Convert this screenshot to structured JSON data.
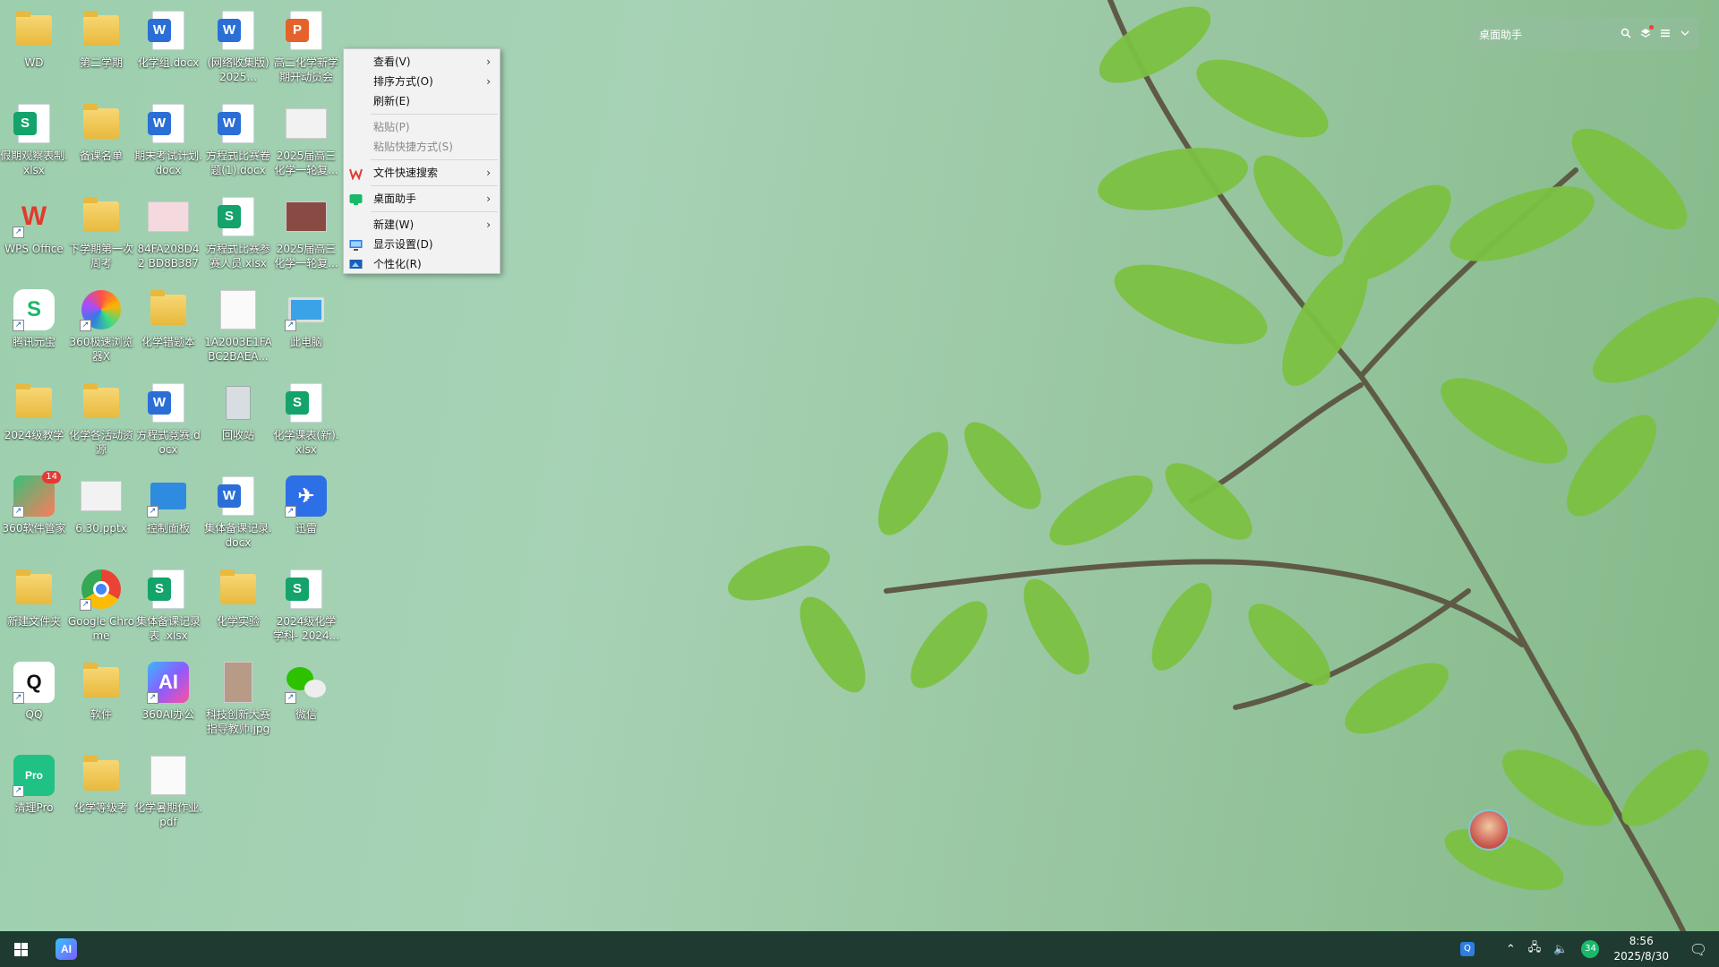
{
  "desktop_icons": [
    {
      "label": "WD",
      "kind": "folder-user"
    },
    {
      "label": "第二学期",
      "kind": "folder"
    },
    {
      "label": "化学组.docx",
      "kind": "word"
    },
    {
      "label": "(网络收集版) 2025...",
      "kind": "word"
    },
    {
      "label": "高二化学新学期开动员会(p...",
      "kind": "ppt"
    },
    {
      "label": "假期观察表制.xlsx",
      "kind": "excel"
    },
    {
      "label": "备课名单",
      "kind": "folder"
    },
    {
      "label": "期末考试计划.docx",
      "kind": "word"
    },
    {
      "label": "方程式比赛卷题(1).docx",
      "kind": "word"
    },
    {
      "label": "2025届高三化学一轮复...",
      "kind": "thumb"
    },
    {
      "label": "WPS Office",
      "kind": "wps"
    },
    {
      "label": "下学期第一次周考",
      "kind": "folder"
    },
    {
      "label": "84FA208D42 BD8B387F...",
      "kind": "thumb-pink"
    },
    {
      "label": "方程式比赛参赛人员.xlsx",
      "kind": "excel"
    },
    {
      "label": "2025届高三化学一轮复...",
      "kind": "thumb-photo"
    },
    {
      "label": "腾讯元宝",
      "kind": "yuanbao"
    },
    {
      "label": "360极速浏览器X",
      "kind": "browser360"
    },
    {
      "label": "化学错题本",
      "kind": "folder-doc"
    },
    {
      "label": "1A2003E1FA BC2BAEA...",
      "kind": "thumb-doc"
    },
    {
      "label": "此电脑",
      "kind": "pc"
    },
    {
      "label": "2024级教学",
      "kind": "folder"
    },
    {
      "label": "化学各活动资源",
      "kind": "folder-word"
    },
    {
      "label": "方程式竞赛.docx",
      "kind": "word"
    },
    {
      "label": "回收站",
      "kind": "recycle"
    },
    {
      "label": "化学课表(新).xlsx",
      "kind": "excel"
    },
    {
      "label": "360软件管家",
      "kind": "mgr360",
      "badge": "14"
    },
    {
      "label": "6.30.pptx",
      "kind": "thumb"
    },
    {
      "label": "控制面板",
      "kind": "control"
    },
    {
      "label": "集体备课记录.docx",
      "kind": "word"
    },
    {
      "label": "迅雷",
      "kind": "xunlei"
    },
    {
      "label": "新建文件夹",
      "kind": "folder"
    },
    {
      "label": "Google Chrome",
      "kind": "chrome"
    },
    {
      "label": "集体备课记录表 .xlsx",
      "kind": "excel"
    },
    {
      "label": "化学实验",
      "kind": "folder-doc"
    },
    {
      "label": "2024级化学学科- 2024...",
      "kind": "excel"
    },
    {
      "label": "QQ",
      "kind": "qq"
    },
    {
      "label": "软件",
      "kind": "folder"
    },
    {
      "label": "360AI办公",
      "kind": "ai360"
    },
    {
      "label": "科技创新大赛指导教师.jpg",
      "kind": "thumb-cert"
    },
    {
      "label": "微信",
      "kind": "wechat"
    },
    {
      "label": "清理Pro",
      "kind": "cleanpro"
    },
    {
      "label": "化学等级考",
      "kind": "folder-excel"
    },
    {
      "label": "化学暑期作业.pdf",
      "kind": "thumb-doc"
    }
  ],
  "context_menu": {
    "items": [
      {
        "label": "查看(V)",
        "submenu": true,
        "disabled": false,
        "icon": ""
      },
      {
        "label": "排序方式(O)",
        "submenu": true,
        "disabled": false,
        "icon": ""
      },
      {
        "label": "刷新(E)",
        "submenu": false,
        "disabled": false,
        "icon": ""
      },
      {
        "sep": true
      },
      {
        "label": "粘贴(P)",
        "submenu": false,
        "disabled": true,
        "icon": ""
      },
      {
        "label": "粘贴快捷方式(S)",
        "submenu": false,
        "disabled": true,
        "icon": ""
      },
      {
        "sep": true
      },
      {
        "label": "文件快速搜索",
        "submenu": true,
        "disabled": false,
        "icon": "wps-search-icon"
      },
      {
        "sep": true
      },
      {
        "label": "桌面助手",
        "submenu": true,
        "disabled": false,
        "icon": "desktop-helper-icon"
      },
      {
        "sep": true
      },
      {
        "label": "新建(W)",
        "submenu": true,
        "disabled": false,
        "icon": ""
      },
      {
        "label": "显示设置(D)",
        "submenu": false,
        "disabled": false,
        "icon": "display-icon"
      },
      {
        "label": "个性化(R)",
        "submenu": false,
        "disabled": false,
        "icon": "personalize-icon"
      }
    ],
    "arrow": "›"
  },
  "helper_widget": {
    "title": "桌面助手"
  },
  "taskbar": {
    "ai_label": "AI",
    "tray_badge": "34",
    "time": "8:56",
    "date": "2025/8/30"
  },
  "colors": {
    "taskbar": "#1f3a30",
    "menu_bg": "#f2f2f2",
    "leaf": "#6fb33a"
  }
}
